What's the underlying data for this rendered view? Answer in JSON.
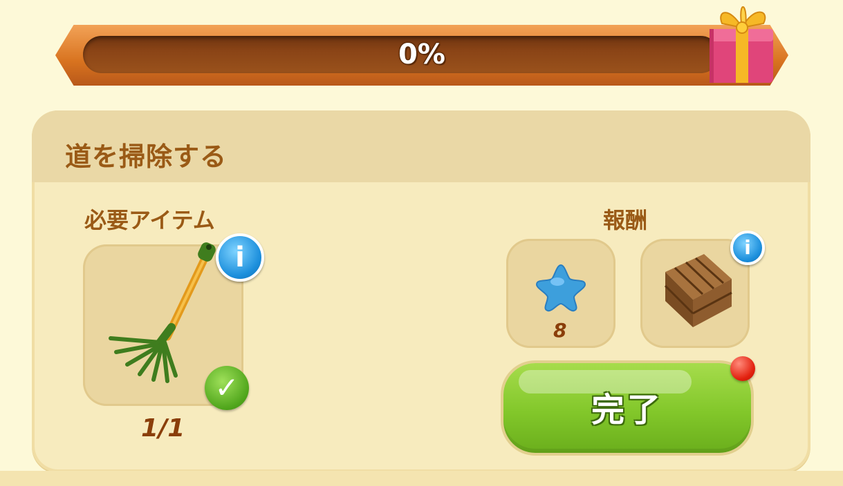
{
  "progress": {
    "label": "0%",
    "fraction": 0.0
  },
  "task": {
    "title": "道を掃除する",
    "required_label": "必要アイテム",
    "required_item": {
      "icon": "rake-icon",
      "count": "1/1",
      "completed": true
    },
    "rewards_label": "報酬",
    "rewards": [
      {
        "icon": "blue-star-icon",
        "amount": "8"
      },
      {
        "icon": "wooden-crate-icon"
      }
    ],
    "done_button": "完了"
  },
  "colors": {
    "title_text": "#9a5a16",
    "done_button": "#82c72a",
    "info_button": "#1c8fdc",
    "progress_frame": "#d8731f"
  }
}
